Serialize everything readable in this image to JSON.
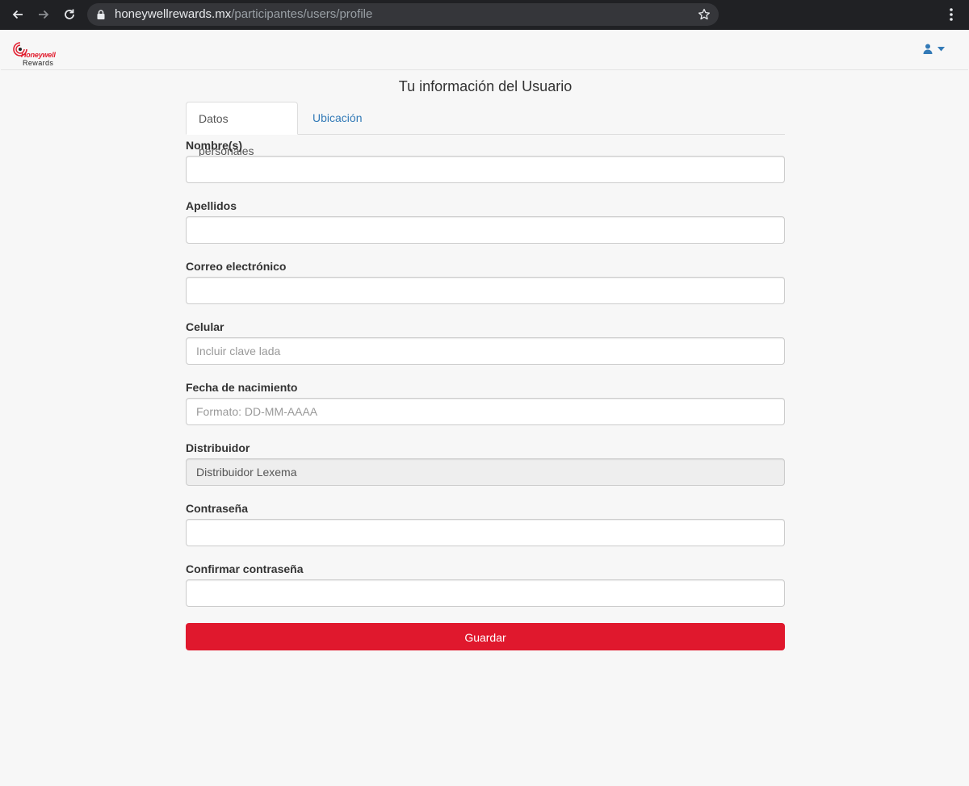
{
  "browser": {
    "url_host": "honeywellrewards.mx",
    "url_path": "/participantes/users/profile"
  },
  "brand": {
    "name": "Honeywell",
    "sub": "Rewards",
    "color": "#e21d2e"
  },
  "page": {
    "title": "Tu información del Usuario"
  },
  "tabs": [
    {
      "label": "Datos personales",
      "active": true
    },
    {
      "label": "Ubicación",
      "active": false
    }
  ],
  "form": {
    "fields": [
      {
        "label": "Nombre(s)",
        "value": "",
        "placeholder": ""
      },
      {
        "label": "Apellidos",
        "value": "",
        "placeholder": ""
      },
      {
        "label": "Correo electrónico",
        "value": "",
        "placeholder": ""
      },
      {
        "label": "Celular",
        "value": "",
        "placeholder": "Incluir clave lada"
      },
      {
        "label": "Fecha de nacimiento",
        "value": "",
        "placeholder": "Formato: DD-MM-AAAA"
      },
      {
        "label": "Distribuidor",
        "value": "Distribuidor Lexema",
        "placeholder": "",
        "readonly": true
      },
      {
        "label": "Contraseña",
        "value": "",
        "placeholder": ""
      },
      {
        "label": "Confirmar contraseña",
        "value": "",
        "placeholder": ""
      }
    ],
    "submit_label": "Guardar"
  },
  "colors": {
    "accent": "#e0182d",
    "link": "#337ab7",
    "user_icon": "#337ab7"
  },
  "icons": {
    "back": "arrow-left-icon",
    "forward": "arrow-right-icon",
    "reload": "reload-icon",
    "lock": "lock-icon",
    "bookmark": "star-icon",
    "menu": "kebab-menu-icon",
    "user": "user-icon",
    "caret": "caret-down-icon"
  }
}
